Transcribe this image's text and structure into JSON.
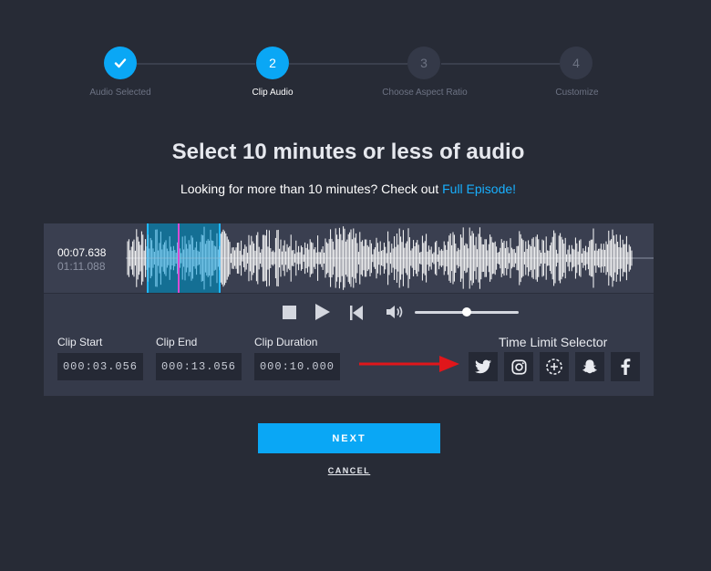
{
  "steps": [
    {
      "label": "Audio Selected",
      "number": "1",
      "state": "done"
    },
    {
      "label": "Clip Audio",
      "number": "2",
      "state": "active"
    },
    {
      "label": "Choose Aspect Ratio",
      "number": "3",
      "state": "todo"
    },
    {
      "label": "Customize",
      "number": "4",
      "state": "todo"
    }
  ],
  "heading": "Select 10 minutes or less of audio",
  "subheading": {
    "text": "Looking for more than 10 minutes? Check out",
    "link": "Full Episode!"
  },
  "player": {
    "current_time": "00:07.638",
    "total_time": "01:11.088",
    "volume": 0.5
  },
  "clip": {
    "start_label": "Clip Start",
    "start_value": "000:03.056",
    "end_label": "Clip End",
    "end_value": "000:13.056",
    "duration_label": "Clip Duration",
    "duration_value": "000:10.000"
  },
  "time_limit": {
    "label": "Time Limit Selector",
    "options": [
      "twitter-icon",
      "instagram-icon",
      "timer-plus-icon",
      "snapchat-icon",
      "facebook-icon"
    ]
  },
  "actions": {
    "next": "NEXT",
    "cancel": "CANCEL"
  },
  "colors": {
    "accent": "#0aa7f5",
    "background": "#272b36",
    "panel": "#353a4a",
    "playhead": "#d84bd2",
    "arrow": "#e0161b"
  }
}
